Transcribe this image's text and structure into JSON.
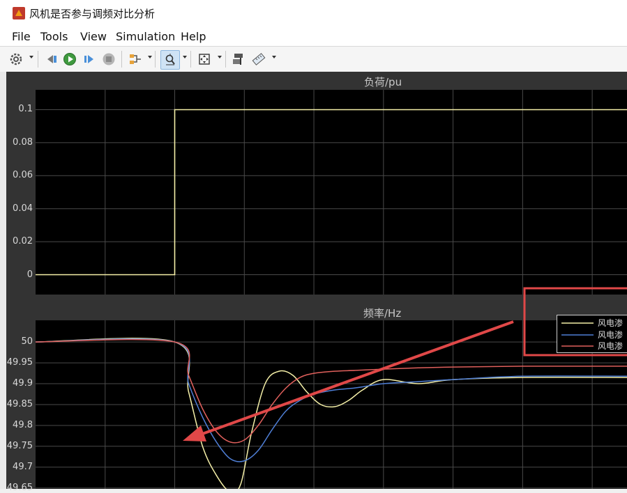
{
  "window": {
    "title": "风机是否参与调频对比分析"
  },
  "menu": {
    "items": [
      "File",
      "Tools",
      "View",
      "Simulation",
      "Help"
    ]
  },
  "toolbar": {
    "icons": [
      "gear-icon",
      "step-back-icon",
      "run-icon",
      "step-forward-icon",
      "stop-icon",
      "signal-selector-icon",
      "zoom-icon",
      "fit-view-icon",
      "properties-icon",
      "measure-icon"
    ]
  },
  "colors": {
    "series_yellow": "#f5f0a8",
    "series_blue": "#4f7fd6",
    "series_red": "#e0605c",
    "annotation_red": "#e04848",
    "grid": "#4a4a4a",
    "plot_bg": "#000000"
  },
  "chart_data": [
    {
      "type": "line",
      "title": "负荷/pu",
      "x": [
        0,
        1,
        1,
        7.5
      ],
      "ylim": [
        -0.012,
        0.112
      ],
      "yticks": [
        "0.1",
        "0.08",
        "0.06",
        "0.04",
        "0.02",
        "0"
      ],
      "ytick_values": [
        0.1,
        0.08,
        0.06,
        0.04,
        0.02,
        0
      ],
      "grid": true,
      "series": [
        {
          "values": [
            0,
            0,
            0.1,
            0.1
          ]
        }
      ]
    },
    {
      "type": "line",
      "title": "频率/Hz",
      "xlim": [
        -1,
        7.5
      ],
      "ylim": [
        49.648,
        50.052
      ],
      "yticks": [
        "50",
        "49.95",
        "49.9",
        "49.85",
        "49.8",
        "49.75",
        "49.7",
        "49.65"
      ],
      "ytick_values": [
        50,
        49.95,
        49.9,
        49.85,
        49.8,
        49.75,
        49.7,
        49.65
      ],
      "grid": true,
      "legend": {
        "placement": "top-right",
        "entries": [
          "风电渗",
          "风电渗",
          "风电渗"
        ]
      },
      "series": [
        {
          "name": "风电渗",
          "color_key": "series_yellow",
          "x": [
            -1,
            1,
            1.2,
            1.4,
            1.6,
            1.8,
            1.95,
            2.1,
            2.3,
            2.5,
            2.7,
            2.9,
            3.1,
            3.3,
            3.5,
            3.7,
            4,
            4.5,
            5,
            6,
            7.5
          ],
          "values": [
            50,
            50,
            49.88,
            49.75,
            49.68,
            49.64,
            49.66,
            49.78,
            49.9,
            49.93,
            49.92,
            49.88,
            49.85,
            49.845,
            49.86,
            49.885,
            49.91,
            49.9,
            49.91,
            49.915,
            49.915
          ]
        },
        {
          "name": "风电渗",
          "color_key": "series_blue",
          "x": [
            -1,
            1,
            1.2,
            1.4,
            1.6,
            1.8,
            2.0,
            2.2,
            2.4,
            2.6,
            2.8,
            3.0,
            3.3,
            3.6,
            4,
            4.5,
            5,
            6,
            7.5
          ],
          "values": [
            50,
            50,
            49.9,
            49.82,
            49.76,
            49.72,
            49.715,
            49.74,
            49.79,
            49.835,
            49.86,
            49.875,
            49.885,
            49.89,
            49.9,
            49.905,
            49.91,
            49.918,
            49.918
          ]
        },
        {
          "name": "风电渗",
          "color_key": "series_red",
          "x": [
            -1,
            1,
            1.2,
            1.4,
            1.6,
            1.8,
            2.0,
            2.2,
            2.4,
            2.6,
            2.8,
            3.0,
            3.3,
            3.6,
            4,
            4.5,
            5,
            6,
            7.5
          ],
          "values": [
            50,
            50,
            49.92,
            49.84,
            49.785,
            49.76,
            49.765,
            49.8,
            49.85,
            49.89,
            49.915,
            49.925,
            49.93,
            49.932,
            49.935,
            49.938,
            49.94,
            49.942,
            49.942
          ]
        }
      ]
    }
  ]
}
